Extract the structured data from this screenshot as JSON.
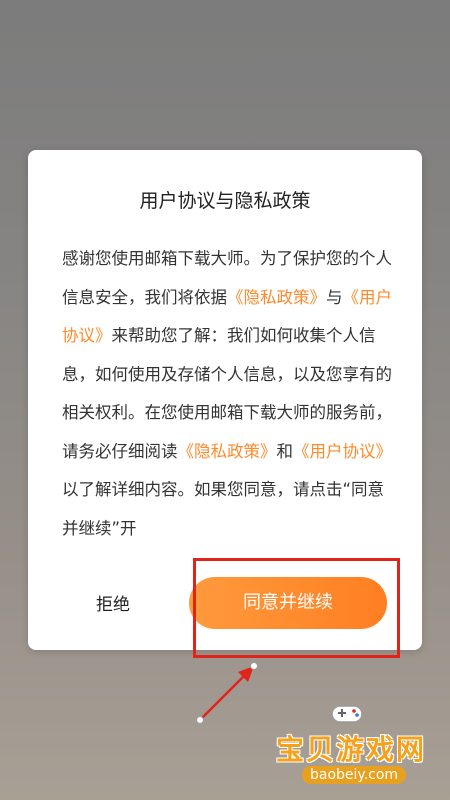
{
  "dialog": {
    "title": "用户协议与隐私政策",
    "body": {
      "p1": "感谢您使用邮箱下载大师。为了保护您的个人信息安全，我们将依据",
      "link_privacy_1": "《隐私政策》",
      "p2": "与",
      "link_user_1": "《用户协议》",
      "p3": "来帮助您了解：我们如何收集个人信息，如何使用及存储个人信息，以及您享有的相关权利。在您使用邮箱下载大师的服务前，请务必仔细阅读",
      "link_privacy_2": "《隐私政策》",
      "p4": "和",
      "link_user_2": "《用户协议》",
      "p5": "以了解详细内容。如果您同意，请点击“同意并继续”开"
    },
    "reject_label": "拒绝",
    "agree_label": "同意并继续"
  },
  "watermark": {
    "title": "宝贝游戏网",
    "url": "baobeiy.com"
  },
  "colors": {
    "accent": "#ff8a2b",
    "highlight": "#e2231a"
  }
}
